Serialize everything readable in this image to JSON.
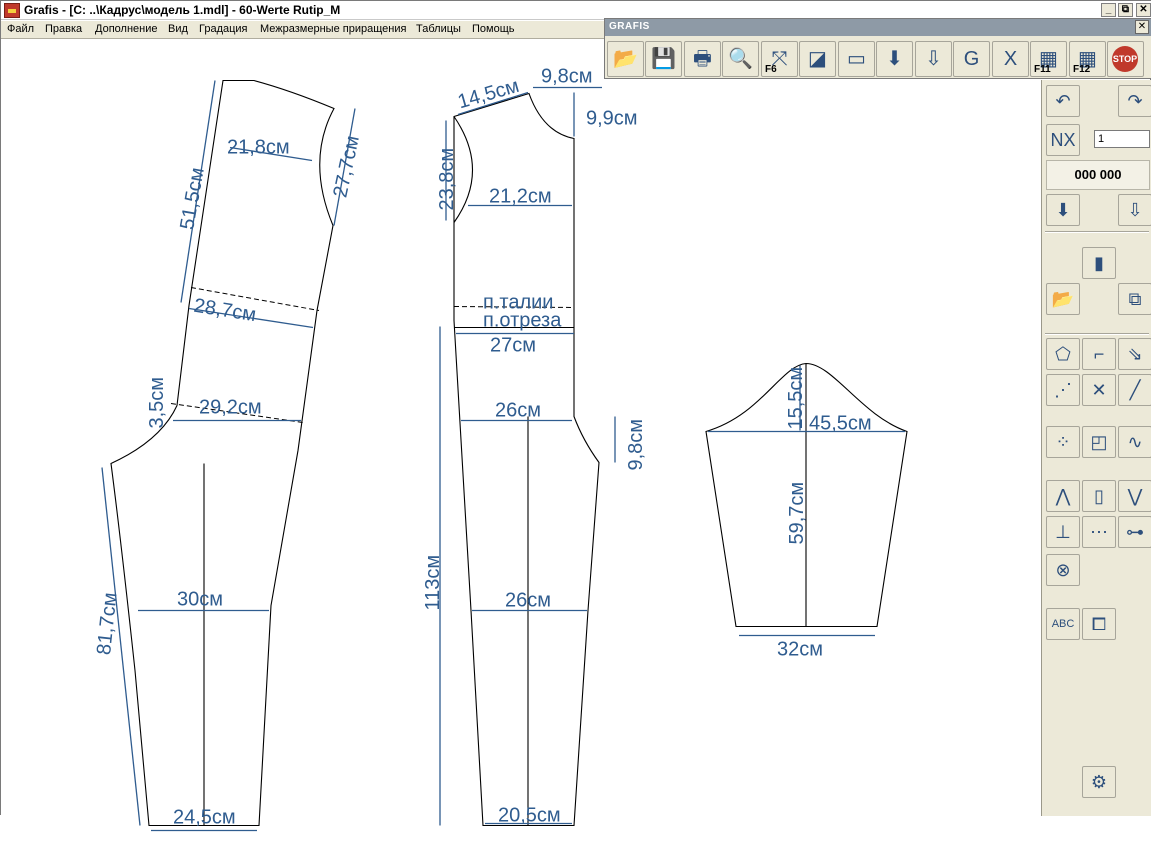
{
  "window": {
    "title": "Grafis - [C: ..\\Кадрус\\модель 1.mdl] - 60-Werte Rutip_M",
    "controls": {
      "minimize": "_",
      "restore": "⧉",
      "close": "✕"
    }
  },
  "menu": {
    "items": [
      {
        "label": "Файл"
      },
      {
        "label": "Правка"
      },
      {
        "label": "Дополнение"
      },
      {
        "label": "Вид"
      },
      {
        "label": "Градация"
      },
      {
        "label": "Межразмерные приращения"
      },
      {
        "label": "Таблицы"
      },
      {
        "label": "Помощь"
      }
    ]
  },
  "toolbar": {
    "title": "GRAFIS",
    "close": "✕",
    "buttons": [
      {
        "icon": "open-folder-icon",
        "glyph": "📂"
      },
      {
        "icon": "save-icon",
        "glyph": "💾"
      },
      {
        "icon": "print-icon",
        "glyph": "🖶"
      },
      {
        "icon": "zoom-icon",
        "glyph": "🔍"
      },
      {
        "icon": "fit-view-icon",
        "glyph": "⤧",
        "key": "F6"
      },
      {
        "icon": "layers-icon",
        "glyph": "◪"
      },
      {
        "icon": "measure-tape-icon",
        "glyph": "▭"
      },
      {
        "icon": "download-arrow-icon",
        "glyph": "⬇"
      },
      {
        "icon": "import-icon",
        "glyph": "⇩"
      },
      {
        "icon": "table-g-icon",
        "glyph": "G"
      },
      {
        "icon": "table-x-icon",
        "glyph": "X"
      },
      {
        "icon": "key-f11-icon",
        "glyph": "▦",
        "key": "F11"
      },
      {
        "icon": "key-f12-icon",
        "glyph": "▦",
        "key": "F12"
      },
      {
        "icon": "stop-icon",
        "glyph": "STOP"
      }
    ]
  },
  "panel": {
    "step_value": "1",
    "coordinates": "000 000",
    "tools": [
      {
        "icon": "undo-icon",
        "glyph": "↶"
      },
      {
        "icon": "redo-icon",
        "glyph": "↷"
      },
      {
        "icon": "nx-step-icon",
        "glyph": "NX"
      },
      {
        "icon": "download-icon",
        "glyph": "⬇"
      },
      {
        "icon": "import-green-icon",
        "glyph": "⇩"
      },
      {
        "icon": "pattern-pieces-icon",
        "glyph": "▮"
      },
      {
        "icon": "open-pattern-icon",
        "glyph": "📂"
      },
      {
        "icon": "copy-pattern-icon",
        "glyph": "⧉"
      },
      {
        "icon": "contour-icon",
        "glyph": "⬠"
      },
      {
        "icon": "corner-lines-icon",
        "glyph": "⌐"
      },
      {
        "icon": "piece-arrow-icon",
        "glyph": "⇘"
      },
      {
        "icon": "points-line-icon",
        "glyph": "⋰"
      },
      {
        "icon": "intersect-icon",
        "glyph": "✕"
      },
      {
        "icon": "line-points-icon",
        "glyph": "╱"
      },
      {
        "icon": "scatter-points-icon",
        "glyph": "⁘"
      },
      {
        "icon": "shapes-icon",
        "glyph": "◰"
      },
      {
        "icon": "curve-icon",
        "glyph": "∿"
      },
      {
        "icon": "dart-icon",
        "glyph": "⋀"
      },
      {
        "icon": "panel-icon",
        "glyph": "▯"
      },
      {
        "icon": "fold-icon",
        "glyph": "⋁"
      },
      {
        "icon": "seam-allowance-icon",
        "glyph": "⊥"
      },
      {
        "icon": "markers-icon",
        "glyph": "⋯"
      },
      {
        "icon": "notch-icon",
        "glyph": "⊶"
      },
      {
        "icon": "delete-point-icon",
        "glyph": "⊗"
      },
      {
        "icon": "text-abc-icon",
        "glyph": "ABC"
      },
      {
        "icon": "template-icon",
        "glyph": "⧠"
      },
      {
        "icon": "sewing-machine-icon",
        "glyph": "⚙"
      }
    ]
  },
  "drawing": {
    "labels": {
      "front_shoulder_height": "51,5см",
      "front_chest": "21,8см",
      "front_armhole": "27,7см",
      "front_waist": "28,7см",
      "front_crotch": "3,5см",
      "front_hip": "29,2см",
      "front_inseam": "81,7см",
      "front_knee": "30см",
      "front_hem": "24,5см",
      "back_shoulder": "14,5см",
      "back_neck_width": "9,8см",
      "back_neck_depth": "9,9см",
      "back_armhole": "23,8см",
      "back_chest": "21,2см",
      "waistline": "п.талии",
      "cut_line": "п.отреза",
      "back_waist": "27см",
      "back_hip": "26см",
      "back_crotch": "9,8см",
      "back_length": "113см",
      "back_knee": "26см",
      "back_hem": "20,5см",
      "sleeve_cap": "15,5см",
      "sleeve_width": "45,5см",
      "sleeve_length": "59,7см",
      "sleeve_cuff": "32см"
    }
  }
}
